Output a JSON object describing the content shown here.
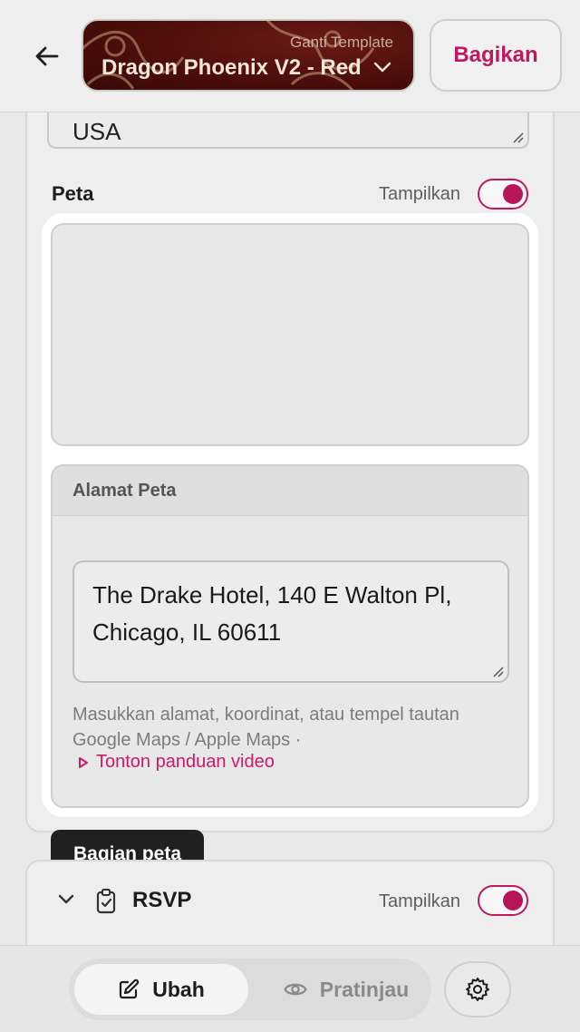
{
  "header": {
    "template_subtitle": "Ganti Template",
    "template_name": "Dragon Phoenix V2 - Red",
    "share_label": "Bagikan"
  },
  "location": {
    "country_value": "USA"
  },
  "map_section": {
    "title": "Peta",
    "toggle_label": "Tampilkan",
    "toggle_on": true,
    "address_header": "Alamat Peta",
    "address_value": "The Drake Hotel, 140 E Walton Pl, Chicago, IL 60611",
    "hint": "Masukkan alamat, koordinat, atau tempel tautan Google Maps / Apple Maps ·",
    "video_link": "Tonton panduan video"
  },
  "tooltip": {
    "text": "Bagian peta"
  },
  "rsvp": {
    "title": "RSVP",
    "toggle_label": "Tampilkan",
    "toggle_on": true
  },
  "bottom_nav": {
    "edit_label": "Ubah",
    "preview_label": "Pratinjau",
    "active": "edit"
  },
  "colors": {
    "accent": "#c0185f",
    "template_bg": "#4a0d0b",
    "tooltip_bg": "#202020"
  }
}
